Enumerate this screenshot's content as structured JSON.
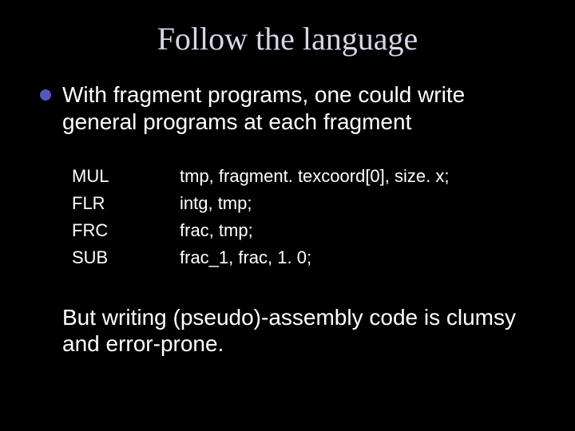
{
  "title": "Follow the language",
  "bullet": "With fragment programs, one could write general programs at each fragment",
  "code": [
    {
      "op": "MUL",
      "args": "tmp, fragment. texcoord[0], size. x;"
    },
    {
      "op": "FLR",
      "args": "intg, tmp;"
    },
    {
      "op": "FRC",
      "args": "frac, tmp;"
    },
    {
      "op": "SUB",
      "args": "frac_1, frac, 1. 0;"
    }
  ],
  "closing": "But writing (pseudo)-assembly code is clumsy and error-prone."
}
